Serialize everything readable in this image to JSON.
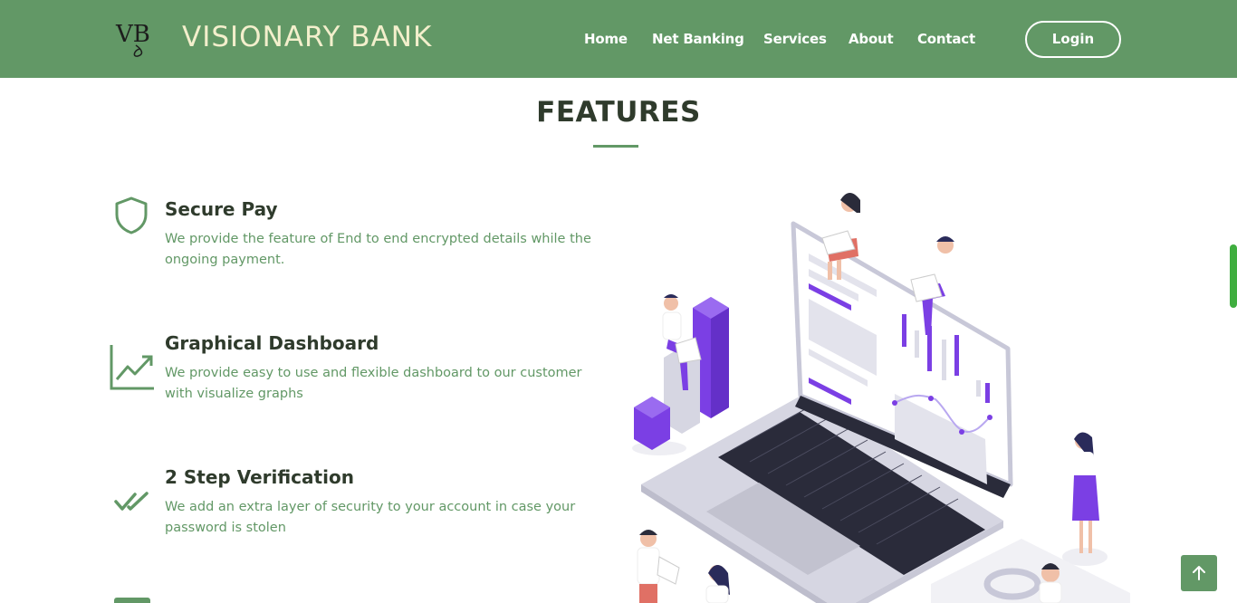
{
  "header": {
    "logo_text": "VB",
    "brand": "VISIONARY BANK",
    "nav": [
      {
        "label": "Home"
      },
      {
        "label": "Net Banking"
      },
      {
        "label": "Services"
      },
      {
        "label": "About"
      },
      {
        "label": "Contact"
      }
    ],
    "login_label": "Login"
  },
  "features_section": {
    "title": "FEATURES",
    "items": [
      {
        "icon": "shield-icon",
        "title": "Secure Pay",
        "description": "We provide the feature of End to end encrypted details while the ongoing payment."
      },
      {
        "icon": "line-chart-icon",
        "title": "Graphical Dashboard",
        "description": "We provide easy to use and flexible dashboard to our customer with visualize graphs"
      },
      {
        "icon": "double-check-icon",
        "title": "2 Step Verification",
        "description": "We add an extra layer of security to your account in case your password is stolen"
      }
    ]
  },
  "colors": {
    "primary": "#629866",
    "heading": "#2f3b2c",
    "brand_text": "#f3efcc",
    "accent_purple": "#7b3fe4"
  },
  "back_to_top_icon": "arrow-up-icon"
}
